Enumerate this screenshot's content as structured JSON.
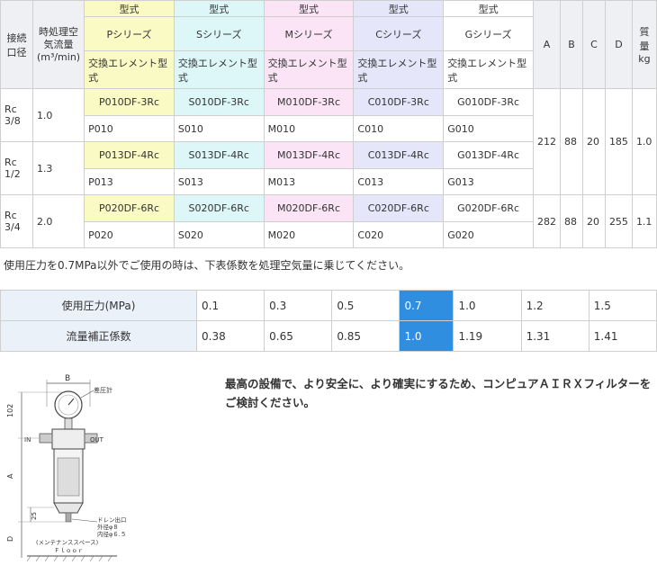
{
  "spec": {
    "headers": {
      "port": "接続口径",
      "flow": "時処理空気流量",
      "flow_unit": "(m³/min)",
      "model": "型式",
      "series": [
        "Pシリーズ",
        "Sシリーズ",
        "Mシリーズ",
        "Cシリーズ",
        "Gシリーズ"
      ],
      "element": "交換エレメント型式",
      "a": "A",
      "b": "B",
      "c": "C",
      "d": "D",
      "mass": "質量kg"
    },
    "rows": [
      {
        "port": "Rc 3/8",
        "flow": "1.0",
        "models": [
          "P010DF-3Rc",
          "S010DF-3Rc",
          "M010DF-3Rc",
          "C010DF-3Rc",
          "G010DF-3Rc"
        ],
        "elements": [
          "P010",
          "S010",
          "M010",
          "C010",
          "G010"
        ]
      },
      {
        "port": "Rc 1/2",
        "flow": "1.3",
        "models": [
          "P013DF-4Rc",
          "S013DF-4Rc",
          "M013DF-4Rc",
          "C013DF-4Rc",
          "G013DF-4Rc"
        ],
        "elements": [
          "P013",
          "S013",
          "M013",
          "C013",
          "G013"
        ]
      },
      {
        "port": "Rc 3/4",
        "flow": "2.0",
        "models": [
          "P020DF-6Rc",
          "S020DF-6Rc",
          "M020DF-6Rc",
          "C020DF-6Rc",
          "G020DF-6Rc"
        ],
        "elements": [
          "P020",
          "S020",
          "M020",
          "C020",
          "G020"
        ]
      }
    ],
    "dims_group1": {
      "a": "212",
      "b": "88",
      "c": "20",
      "d": "185",
      "mass": "1.0"
    },
    "dims_group2": {
      "a": "282",
      "b": "88",
      "c": "20",
      "d": "255",
      "mass": "1.1"
    }
  },
  "note": "使用圧力を0.7MPa以外でご使用の時は、下表係数を処理空気量に乗じてください。",
  "factor": {
    "pressure_label": "使用圧力(MPa)",
    "pressures": [
      "0.1",
      "0.3",
      "0.5",
      "0.7",
      "1.0",
      "1.2",
      "1.5"
    ],
    "coef_label": "流量補正係数",
    "coefs": [
      "0.38",
      "0.65",
      "0.85",
      "1.0",
      "1.19",
      "1.31",
      "1.41"
    ],
    "highlight_color": "#2f8ee0"
  },
  "message": "最高の設備で、より安全に、より確実にするため、コンピュアＡＩＲＸフィルターをご検討ください。",
  "diagram": {
    "gauge": "差圧計",
    "b": "B",
    "dim_102": "102",
    "in": "IN",
    "out": "OUT",
    "a": "A",
    "dim_25": "25",
    "drain1": "ドレン出口",
    "drain2": "外径φ８",
    "drain3": "内径φ６.５",
    "d": "D",
    "maint": "(メンテナンススペース)",
    "floor": "Ｆｌｏｏｒ"
  }
}
